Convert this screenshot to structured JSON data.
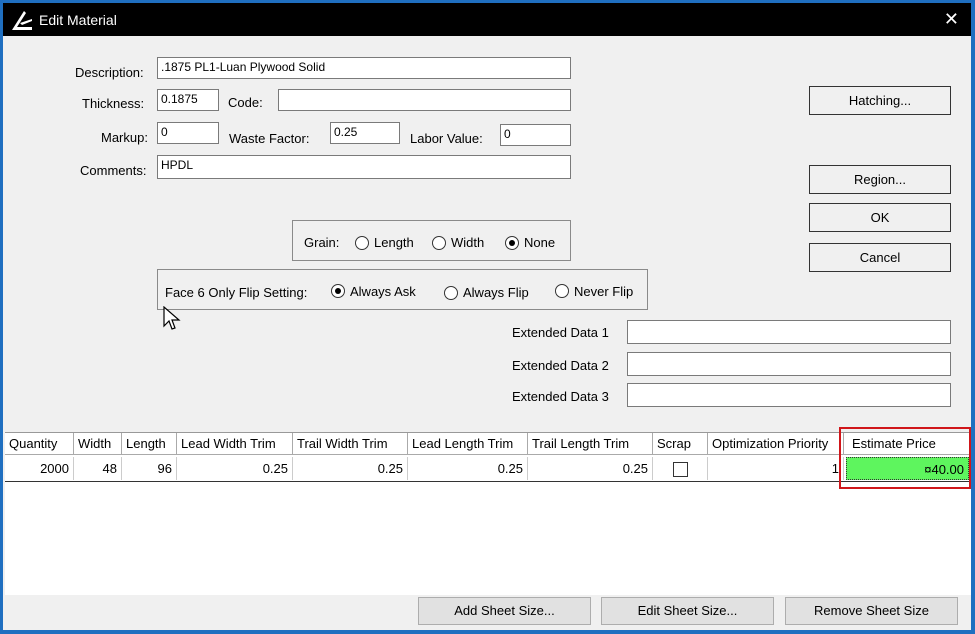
{
  "window": {
    "title": "Edit Material",
    "close_glyph": "✕"
  },
  "form": {
    "description_label": "Description:",
    "description_value": ".1875 PL1-Luan Plywood Solid",
    "thickness_label": "Thickness:",
    "thickness_value": "0.1875",
    "code_label": "Code:",
    "code_value": "",
    "markup_label": "Markup:",
    "markup_value": "0",
    "waste_label": "Waste Factor:",
    "waste_value": "0.25",
    "labor_label": "Labor Value:",
    "labor_value": "0",
    "comments_label": "Comments:",
    "comments_value": "HPDL"
  },
  "grain": {
    "label": "Grain:",
    "options": [
      "Length",
      "Width",
      "None"
    ],
    "selected": "None"
  },
  "flip": {
    "label": "Face 6 Only Flip Setting:",
    "options": [
      "Always Ask",
      "Always Flip",
      "Never Flip"
    ],
    "selected": "Always Ask"
  },
  "extended": {
    "labels": [
      "Extended Data 1",
      "Extended Data 2",
      "Extended Data 3"
    ],
    "values": [
      "",
      "",
      ""
    ]
  },
  "buttons": {
    "hatching": "Hatching...",
    "region": "Region...",
    "ok": "OK",
    "cancel": "Cancel",
    "add_sheet": "Add Sheet Size...",
    "edit_sheet": "Edit Sheet Size...",
    "remove_sheet": "Remove Sheet Size"
  },
  "table": {
    "headers": [
      "Quantity",
      "Width",
      "Length",
      "Lead Width Trim",
      "Trail Width Trim",
      "Lead Length Trim",
      "Trail Length Trim",
      "Scrap",
      "Optimization Priority",
      "Estimate Price"
    ],
    "rows": [
      [
        "2000",
        "48",
        "96",
        "0.25",
        "0.25",
        "0.25",
        "0.25",
        "",
        "1",
        "¤40.00"
      ]
    ],
    "scrap_checked": false
  },
  "colors": {
    "estimate_highlight": "#5ef55e",
    "annotation_box": "#d0161a",
    "frame": "#1f6fc0"
  }
}
